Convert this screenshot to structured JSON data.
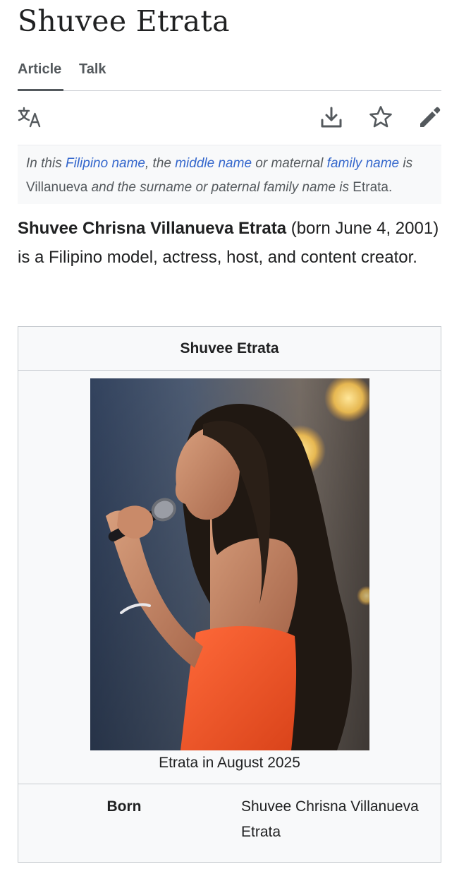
{
  "page": {
    "title": "Shuvee Etrata"
  },
  "tabs": [
    {
      "label": "Article",
      "selected": true
    },
    {
      "label": "Talk",
      "selected": false
    }
  ],
  "toolbar": {
    "icons": [
      "language-icon",
      "download-icon",
      "star-icon",
      "edit-pencil-icon"
    ]
  },
  "hatnote": {
    "p1": "In this ",
    "link1": "Filipino name",
    "p2": ", the ",
    "link2": "middle name",
    "p3": " or maternal ",
    "link3": "family name",
    "p4": " is ",
    "middle": "Villanueva",
    "p5": " and the surname or paternal family name is ",
    "surname": "Etrata",
    "p6": "."
  },
  "lead": {
    "full_name": "Shuvee Chrisna Villanueva Etrata",
    "text": " (born June 4, 2001) is a Filipino model, actress, host, and content creator."
  },
  "infobox": {
    "title": "Shuvee Etrata",
    "caption": "Etrata in August 2025",
    "rows": [
      {
        "label": "Born",
        "value": "Shuvee Chrisna Villanueva Etrata"
      }
    ]
  },
  "colors": {
    "link": "#3366cc",
    "text": "#202122",
    "muted": "#54595d",
    "border": "#c8ccd1",
    "panel": "#f8f9fa"
  }
}
